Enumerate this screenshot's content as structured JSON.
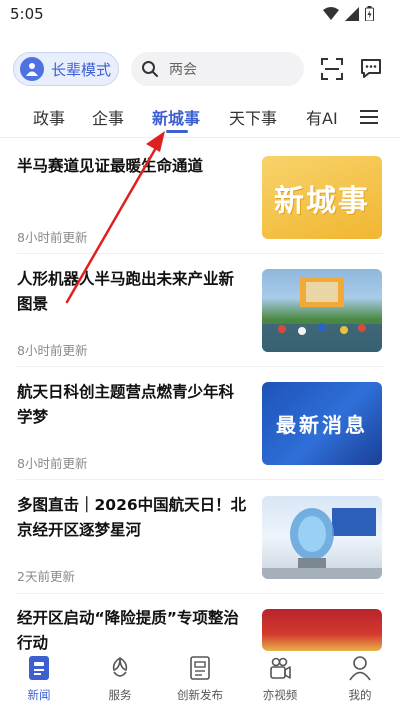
{
  "status_bar": {
    "time": "5:05"
  },
  "header": {
    "elder_mode_label": "长辈模式",
    "search_placeholder": "两会"
  },
  "tabs": [
    {
      "label": "政事",
      "active": false
    },
    {
      "label": "企事",
      "active": false
    },
    {
      "label": "新城事",
      "active": true
    },
    {
      "label": "天下事",
      "active": false
    },
    {
      "label": "有AI",
      "active": false
    }
  ],
  "news": [
    {
      "title": "半马赛道见证最暖生命通道",
      "time": "8小时前更新",
      "thumb_text": "新城事"
    },
    {
      "title": "人形机器人半马跑出未来产业新图景",
      "time": "8小时前更新",
      "thumb_text": ""
    },
    {
      "title": "航天日科创主题营点燃青少年科学梦",
      "time": "8小时前更新",
      "thumb_text": "最新消息"
    },
    {
      "title": "多图直击｜2026中国航天日！北京经开区逐梦星河",
      "time": "2天前更新",
      "thumb_text": ""
    },
    {
      "title": "经开区启动“降险提质”专项整治行动",
      "time": "",
      "thumb_text": ""
    }
  ],
  "bottom_nav": [
    {
      "label": "新闻",
      "icon": "news-icon",
      "active": true
    },
    {
      "label": "服务",
      "icon": "service-icon",
      "active": false
    },
    {
      "label": "创新发布",
      "icon": "publish-icon",
      "active": false
    },
    {
      "label": "亦视频",
      "icon": "video-icon",
      "active": false
    },
    {
      "label": "我的",
      "icon": "profile-icon",
      "active": false
    }
  ],
  "colors": {
    "accent": "#3d5fd1",
    "annotation": "#e02020"
  }
}
